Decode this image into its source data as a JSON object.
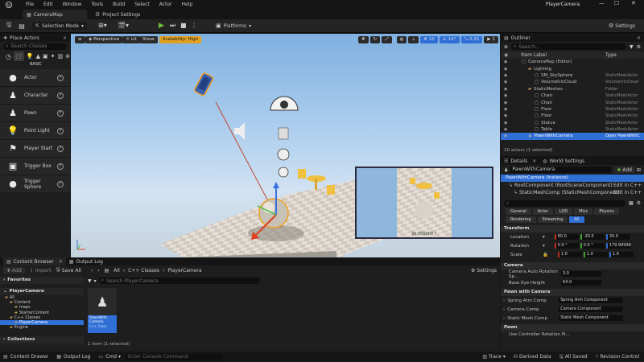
{
  "menu": [
    "File",
    "Edit",
    "Window",
    "Tools",
    "Build",
    "Select",
    "Actor",
    "Help"
  ],
  "window_title": "PlayerCamera",
  "tabs": {
    "map": "CameraMap",
    "project_settings": "Project Settings"
  },
  "toolbar": {
    "selection_mode": "Selection Mode",
    "platforms": "Platforms",
    "settings": "Settings"
  },
  "place_actors": {
    "title": "Place Actors",
    "search_placeholder": "Search Classes",
    "category": "BASIC",
    "items": [
      {
        "label": "Actor",
        "icon": "sphere-icon"
      },
      {
        "label": "Character",
        "icon": "pawn-icon"
      },
      {
        "label": "Pawn",
        "icon": "pawn-icon"
      },
      {
        "label": "Point Light",
        "icon": "bulb-icon"
      },
      {
        "label": "Player Start",
        "icon": "flag-icon"
      },
      {
        "label": "Trigger Box",
        "icon": "box-icon"
      },
      {
        "label": "Trigger Sphere",
        "icon": "sphere-icon"
      }
    ]
  },
  "viewport": {
    "perspective": "Perspective",
    "lit": "Lit",
    "show": "Show",
    "scalability": "Scalability: High",
    "grid_snap": "10",
    "rot_snap": "10°",
    "scale_snap": "0.25",
    "cam_speed": "1",
    "pip_label": "30.000000 °"
  },
  "outliner": {
    "title": "Outliner",
    "search_placeholder": "Search...",
    "col_label": "Item Label",
    "col_type": "Type",
    "rows": [
      {
        "label": "CameraMap (Editor)",
        "type": "",
        "indent": 0
      },
      {
        "label": "Lighting",
        "type": "",
        "indent": 1
      },
      {
        "label": "SM_SkySphere",
        "type": "StaticMeshActor",
        "indent": 2
      },
      {
        "label": "VolumetricCloud",
        "type": "VolumetricCloud",
        "indent": 2
      },
      {
        "label": "StaticMeshes",
        "type": "Folder",
        "indent": 1
      },
      {
        "label": "Chair",
        "type": "StaticMeshActor",
        "indent": 2
      },
      {
        "label": "Chair",
        "type": "StaticMeshActor",
        "indent": 2
      },
      {
        "label": "Floor",
        "type": "StaticMeshActor",
        "indent": 2
      },
      {
        "label": "Floor",
        "type": "StaticMeshActor",
        "indent": 2
      },
      {
        "label": "Statue",
        "type": "StaticMeshActor",
        "indent": 2
      },
      {
        "label": "Table",
        "type": "StaticMeshActor",
        "indent": 2
      },
      {
        "label": "PawnWithCamera",
        "type": "Open PawnWithC",
        "indent": 1
      }
    ],
    "footer": "10 actors (1 selected)"
  },
  "details": {
    "tab_details": "Details",
    "tab_world": "World Settings",
    "actor_name": "PawnWithCamera",
    "add_label": "Add",
    "instance": "PawnWithCamera (Instance)",
    "root_comp": "RootComponent (RootSceneComponent)",
    "mesh_comp": "StaticMeshComp (StaticMeshComponent)",
    "edit_cpp": "Edit in C++",
    "filters_row1": [
      "General",
      "Actor",
      "LOD",
      "Misc",
      "Physics"
    ],
    "filters_row2": [
      "Rendering",
      "Streaming",
      "All"
    ],
    "sections": {
      "transform": "Transform",
      "camera": "Camera",
      "pawn_with_camera": "Pawn with Camera",
      "pawn": "Pawn"
    },
    "location": {
      "label": "Location",
      "x": "80.0",
      "y": "-20.0",
      "z": "30.0"
    },
    "rotation": {
      "label": "Rotation",
      "x": "0.0 °",
      "y": "0.0 °",
      "z": "179.99999"
    },
    "scale": {
      "label": "Scale",
      "x": "1.0",
      "y": "1.0",
      "z": "1.0"
    },
    "camera_auto_rot": {
      "label": "Camera Auto Rotation Sp...",
      "value": "3.0"
    },
    "base_eye": {
      "label": "Base Eye Height",
      "value": "64.0"
    },
    "spring_arm": {
      "label": "Spring Arm Comp",
      "value": "Spring Arm Component"
    },
    "camera_comp": {
      "label": "Camera Comp",
      "value": "Camera Component"
    },
    "static_mesh": {
      "label": "Static Mesh Comp",
      "value": "Static Mesh Component"
    },
    "use_ctrl_rot": "Use Controller Rotation Pi..."
  },
  "content_browser": {
    "tab": "Content Browser",
    "tab2": "Output Log",
    "add": "Add",
    "import": "Import",
    "save_all": "Save All",
    "path": [
      "All",
      "C++ Classes",
      "PlayerCamera"
    ],
    "settings": "Settings",
    "favorites": "Favorites",
    "project": "PlayerCamera",
    "search_placeholder": "Search PlayerCamera",
    "tree": [
      {
        "label": "All",
        "indent": 0
      },
      {
        "label": "Content",
        "indent": 1
      },
      {
        "label": "maps",
        "indent": 2
      },
      {
        "label": "StarterContent",
        "indent": 2
      },
      {
        "label": "C++ Classes",
        "indent": 1
      },
      {
        "label": "PlayerCamera",
        "indent": 2,
        "selected": true
      },
      {
        "label": "Engine",
        "indent": 1
      }
    ],
    "collections": "Collections",
    "asset": {
      "name": "PawnWith Camera",
      "type": "C++ Class"
    },
    "count": "1 item (1 selected)"
  },
  "statusbar": {
    "content_drawer": "Content Drawer",
    "output_log": "Output Log",
    "cmd": "Cmd",
    "console_placeholder": "Enter Console Command",
    "trace": "Trace",
    "derived": "Derived Data",
    "all_saved": "All Saved",
    "revision": "Revision Control"
  }
}
